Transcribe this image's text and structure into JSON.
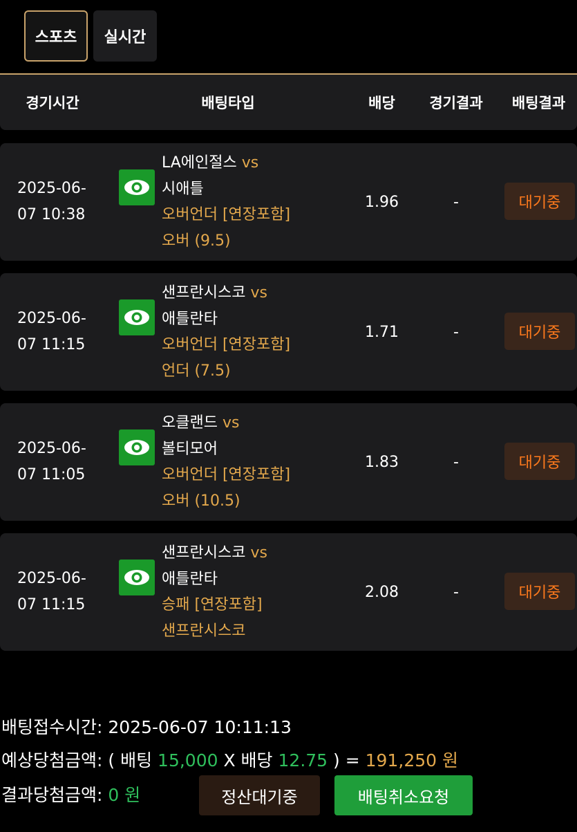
{
  "tabs": [
    {
      "label": "스포츠",
      "active": true
    },
    {
      "label": "실시간",
      "active": false
    }
  ],
  "table": {
    "headers": [
      "경기시간",
      "배팅타입",
      "배당",
      "경기결과",
      "배팅결과"
    ],
    "rows": [
      {
        "date": "2025-06-",
        "time": "07 10:38",
        "team1": "LA에인절스",
        "vs": "vs",
        "team2": "시애틀",
        "bet_type": "오버언더 [연장포함]",
        "pick": "오버 (9.5)",
        "odds": "1.96",
        "result": "-",
        "status": "대기중"
      },
      {
        "date": "2025-06-",
        "time": "07 11:15",
        "team1": "샌프란시스코",
        "vs": "vs",
        "team2": "애틀란타",
        "bet_type": "오버언더 [연장포함]",
        "pick": "언더 (7.5)",
        "odds": "1.71",
        "result": "-",
        "status": "대기중"
      },
      {
        "date": "2025-06-",
        "time": "07 11:05",
        "team1": "오클랜드",
        "vs": "vs",
        "team2": "볼티모어",
        "bet_type": "오버언더 [연장포함]",
        "pick": "오버 (10.5)",
        "odds": "1.83",
        "result": "-",
        "status": "대기중"
      },
      {
        "date": "2025-06-",
        "time": "07 11:15",
        "team1": "샌프란시스코",
        "vs": "vs",
        "team2": "애틀란타",
        "bet_type": "승패 [연장포함]",
        "pick": "샌프란시스코",
        "odds": "2.08",
        "result": "-",
        "status": "대기중"
      }
    ]
  },
  "summary": {
    "received_label": "배팅접수시간:",
    "received_value": "2025-06-07 10:11:13",
    "expected_label": "예상당첨금액:",
    "open_paren": "( 배팅",
    "stake": "15,000",
    "times": "X 배당",
    "total_odds": "12.75",
    "close_paren": ") =",
    "expected_amount": "191,250 원",
    "result_label": "결과당첨금액:",
    "result_amount": "0 원"
  },
  "buttons": {
    "settle_label": "정산대기중",
    "cancel_label": "배팅취소요청"
  },
  "colors": {
    "accent_gold": "#e3a84c",
    "green": "#1f9e3a",
    "status_orange": "#ff7a1c"
  }
}
